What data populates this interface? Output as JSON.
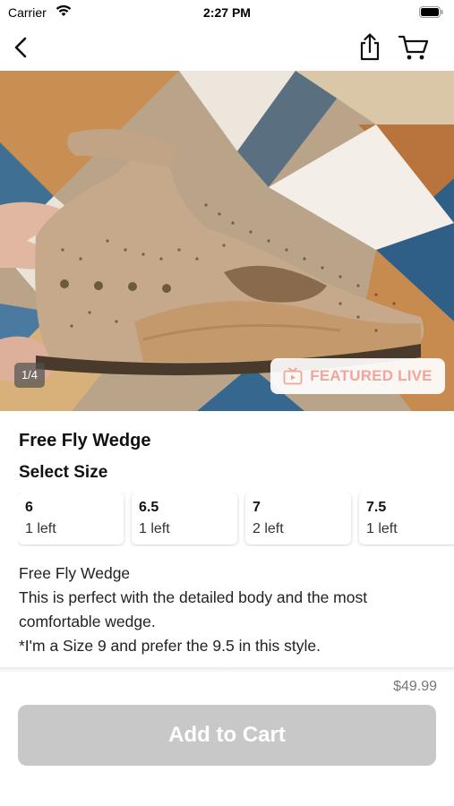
{
  "status_bar": {
    "carrier": "Carrier",
    "time": "2:27 PM"
  },
  "nav": {
    "back_icon": "chevron-left-icon",
    "share_icon": "share-icon",
    "cart_icon": "cart-icon"
  },
  "gallery": {
    "counter": "1/4",
    "badge_label": "FEATURED LIVE",
    "badge_color": "#f0a69a"
  },
  "product": {
    "title": "Free Fly Wedge",
    "select_size_label": "Select Size",
    "sizes": [
      {
        "size": "6",
        "stock": "1 left"
      },
      {
        "size": "6.5",
        "stock": "1 left"
      },
      {
        "size": "7",
        "stock": "2 left"
      },
      {
        "size": "7.5",
        "stock": "1 left"
      }
    ],
    "description": [
      "Free Fly Wedge",
      "This is perfect with the detailed body and the most comfortable wedge.",
      "*I'm a Size 9 and prefer the 9.5 in this style."
    ],
    "price": "$49.99"
  },
  "footer": {
    "add_to_cart_label": "Add to Cart",
    "button_color": "#c8c8c8"
  }
}
